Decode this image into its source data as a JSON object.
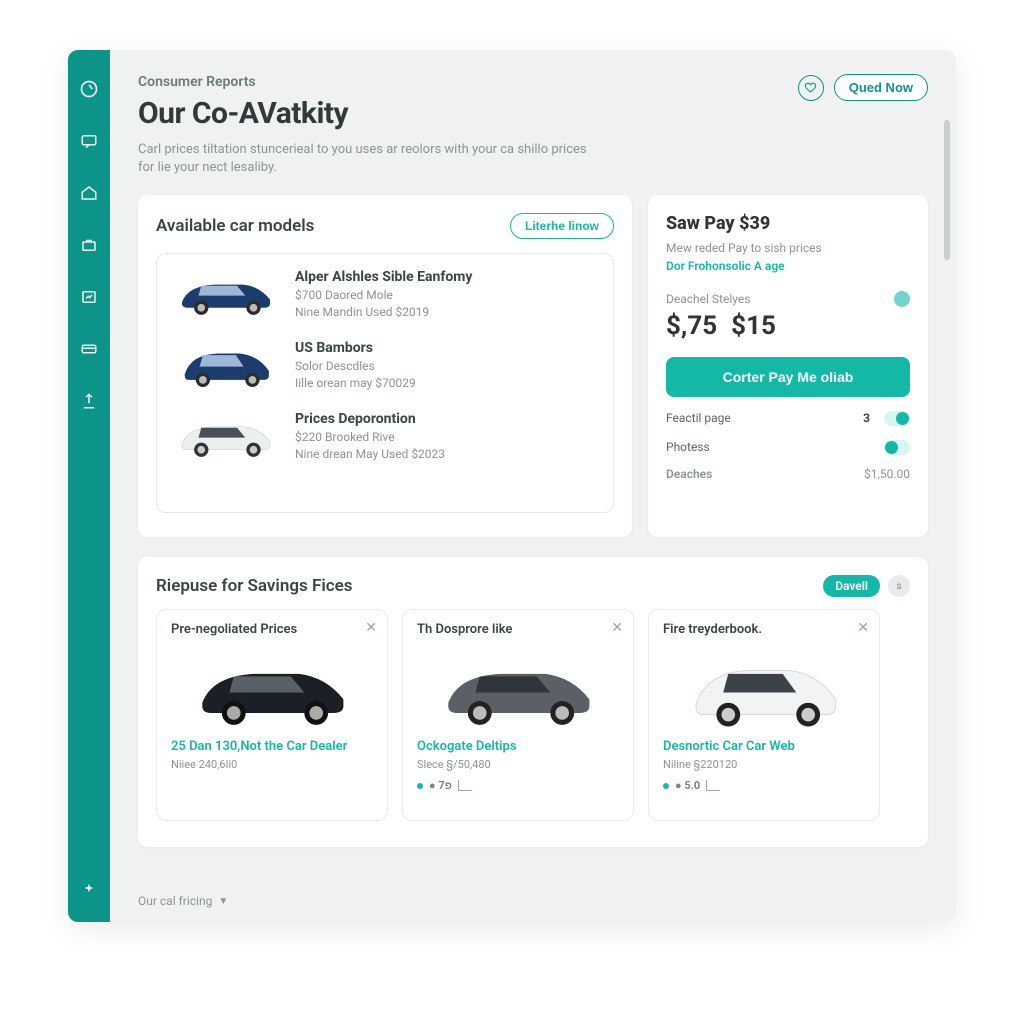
{
  "breadcrumb": "Consumer Reports",
  "page_title": "Our Co-AVatkity",
  "page_sub": "Carl prices tiltation stuncerieal to you uses ar reolors with your ca shillo prices for lie your nect lesaliby.",
  "top_actions": {
    "quote": "Qued Now"
  },
  "sidebar_icons": [
    "dashboard-icon",
    "chat-icon",
    "home-icon",
    "briefcase-icon",
    "chart-icon",
    "card-icon",
    "upload-icon",
    "sparkle-icon"
  ],
  "models": {
    "title": "Available car models",
    "button": "Literhe linow",
    "items": [
      {
        "name": "Alper Alshles Sible Eanfomy",
        "line1": "$700 Daored Mole",
        "line2": "Nine Mandin Used $2019",
        "color": "#1d3c6e"
      },
      {
        "name": "US Bambors",
        "line1": "Solor Descdles",
        "line2": "Iille orean may $70029",
        "color": "#1d3c6e"
      },
      {
        "name": "Prices Deporontion",
        "line1": "$220 Brooked Rive",
        "line2": "Nine drean May Used $2023",
        "color": "#eceff0"
      }
    ]
  },
  "pay": {
    "title": "Saw Pay $39",
    "sub1": "Mew reded Pay to sish prices",
    "sub2": "Dor Frohonsolic A age",
    "label": "Deachel Stelyes",
    "amt1": "$,75",
    "amt2": "$15",
    "cta": "Corter Pay Me oliab",
    "toggle1_label": "Feactil page",
    "toggle1_num": "3",
    "toggle2_label": "Photess",
    "deaches_label": "Deaches",
    "deaches_value": "$1,50.00"
  },
  "savings": {
    "title": "Riepuse for Savings Fices",
    "badge": "Davell",
    "chip": "s",
    "tiles": [
      {
        "title": "Pre-negoliated Prices",
        "link": "25 Dan 130,Not the Car Dealer",
        "meta": "Niiee 240,6Ii0",
        "dots": "",
        "color": "#1b1f26"
      },
      {
        "title": "Th Dosprore like",
        "link": "Ockogate Deltips",
        "meta": "Slece §/50,480",
        "dots": "● פ7",
        "color": "#5a6066"
      },
      {
        "title": "Fire treyderbook.",
        "link": "Desnortic Car Car Web",
        "meta": "Niline §220120",
        "dots": "● 5.0",
        "color": "#f1f3f4"
      }
    ]
  },
  "footer": "Our cal fricing"
}
